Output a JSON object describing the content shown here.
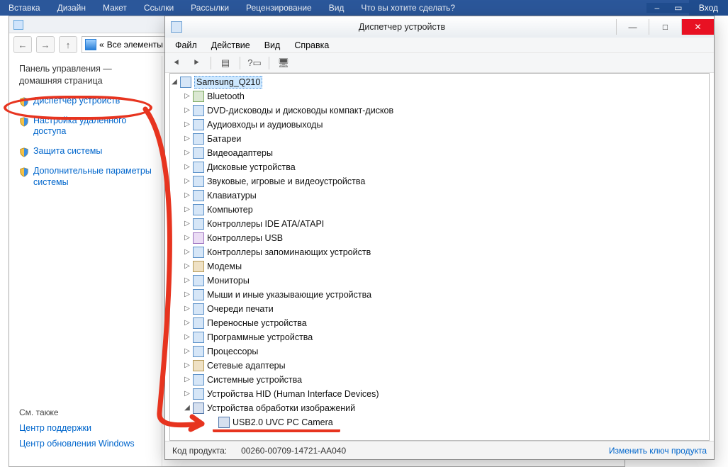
{
  "ribbon": {
    "tabs": [
      "Вставка",
      "Дизайн",
      "Макет",
      "Ссылки",
      "Рассылки",
      "Рецензирование",
      "Вид",
      "Что вы хотите сделать?"
    ],
    "enter": "Вход"
  },
  "cp": {
    "breadcrumb_prefix": "«",
    "breadcrumb": "Все элементы",
    "left_header1": "Панель управления —",
    "left_header2": "домашняя страница",
    "links": [
      "Диспетчер устройств",
      "Настройка удаленного доступа",
      "Защита системы",
      "Дополнительные параметры системы"
    ],
    "see_also": "См. также",
    "support": "Центр поддержки",
    "winupdate": "Центр обновления Windows"
  },
  "dm": {
    "title": "Диспетчер устройств",
    "menus": [
      "Файл",
      "Действие",
      "Вид",
      "Справка"
    ],
    "root": "Samsung_Q210",
    "categories": [
      "Bluetooth",
      "DVD-дисководы и дисководы компакт-дисков",
      "Аудиовходы и аудиовыходы",
      "Батареи",
      "Видеоадаптеры",
      "Дисковые устройства",
      "Звуковые, игровые и видеоустройства",
      "Клавиатуры",
      "Компьютер",
      "Контроллеры IDE ATA/ATAPI",
      "Контроллеры USB",
      "Контроллеры запоминающих устройств",
      "Модемы",
      "Мониторы",
      "Мыши и иные указывающие устройства",
      "Очереди печати",
      "Переносные устройства",
      "Программные устройства",
      "Процессоры",
      "Сетевые адаптеры",
      "Системные устройства",
      "Устройства HID (Human Interface Devices)"
    ],
    "open_category": "Устройства обработки изображений",
    "open_child": "USB2.0 UVC PC Camera",
    "product_label": "Код продукта:",
    "product_value": "00260-00709-14721-AA040",
    "change_key": "Изменить ключ продукта"
  }
}
